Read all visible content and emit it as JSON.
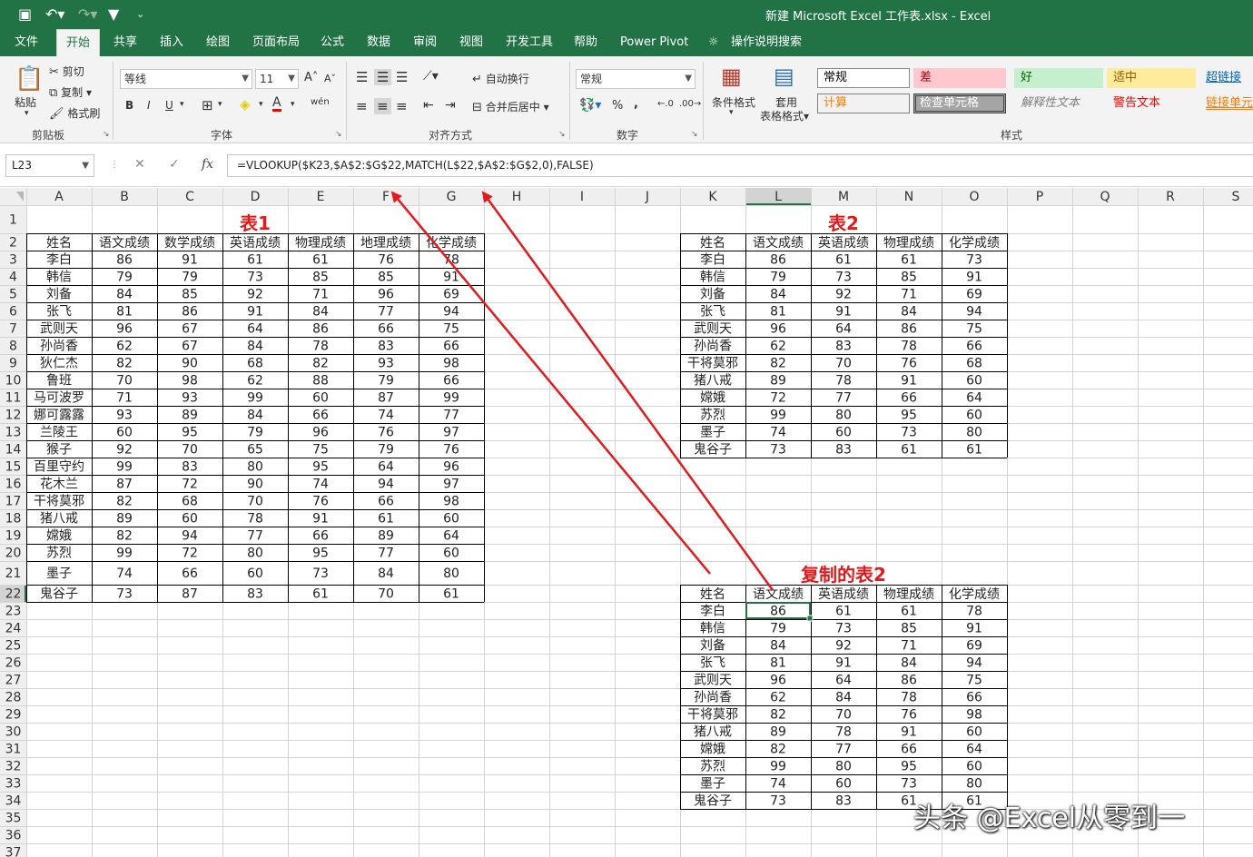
{
  "titlebar": {
    "title": "新建 Microsoft Excel 工作表.xlsx  -  Excel",
    "qa_icons": [
      "save-icon",
      "undo-icon",
      "redo-icon",
      "filter-icon",
      "customize-icon"
    ]
  },
  "tabs": [
    "文件",
    "开始",
    "共享",
    "插入",
    "绘图",
    "页面布局",
    "公式",
    "数据",
    "审阅",
    "视图",
    "开发工具",
    "帮助",
    "Power Pivot",
    "操作说明搜索"
  ],
  "active_tab": "开始",
  "ribbon": {
    "clipboard": {
      "paste": "粘贴",
      "cut": "剪切",
      "copy": "复制",
      "format_painter": "格式刷",
      "group": "剪贴板"
    },
    "font": {
      "name": "等线",
      "size": "11",
      "group": "字体",
      "bold": "B",
      "italic": "I",
      "underline": "U",
      "grow": "A˄",
      "shrink": "A˅",
      "wen": "wén"
    },
    "align": {
      "wrap": "自动换行",
      "merge": "合并后居中",
      "group": "对齐方式"
    },
    "number": {
      "format": "常规",
      "percent": "%",
      "comma": ",",
      "group": "数字"
    },
    "styles": {
      "cond": "条件格式",
      "table1": "套用",
      "table2": "表格格式",
      "group": "样式",
      "cells": [
        {
          "label": "常规",
          "bg": "#ffffff",
          "fg": "#000000",
          "border": "#8a8a8a"
        },
        {
          "label": "差",
          "bg": "#ffc7ce",
          "fg": "#9c0006",
          "border": "#ffc7ce"
        },
        {
          "label": "好",
          "bg": "#c6efce",
          "fg": "#006100",
          "border": "#c6efce"
        },
        {
          "label": "适中",
          "bg": "#ffeb9c",
          "fg": "#9c5700",
          "border": "#ffeb9c"
        },
        {
          "label": "超链接",
          "bg": "#f3f3f3",
          "fg": "#0563c1",
          "border": "#f3f3f3"
        },
        {
          "label": "计算",
          "bg": "#f2f2f2",
          "fg": "#fa7d00",
          "border": "#7f7f7f"
        },
        {
          "label": "检查单元格",
          "bg": "#a5a5a5",
          "fg": "#ffffff",
          "border": "#3f3f3f"
        },
        {
          "label": "解释性文本",
          "bg": "#f3f3f3",
          "fg": "#7f7f7f",
          "border": "#f3f3f3"
        },
        {
          "label": "警告文本",
          "bg": "#f3f3f3",
          "fg": "#ff0000",
          "border": "#f3f3f3"
        },
        {
          "label": "链接单元",
          "bg": "#f3f3f3",
          "fg": "#fa7d00",
          "border": "#f3f3f3"
        }
      ]
    }
  },
  "formula_bar": {
    "cell_ref": "L23",
    "fx": "fx",
    "formula": "=VLOOKUP($K23,$A$2:$G$22,MATCH(L$22,$A$2:$G$2,0),FALSE)"
  },
  "sheet": {
    "columns": [
      "A",
      "B",
      "C",
      "D",
      "E",
      "F",
      "G",
      "H",
      "I",
      "J",
      "K",
      "L",
      "M",
      "N",
      "O",
      "P",
      "Q",
      "R",
      "S"
    ],
    "rows": [
      "1",
      "2",
      "3",
      "4",
      "5",
      "6",
      "7",
      "8",
      "9",
      "10",
      "11",
      "12",
      "13",
      "14",
      "15",
      "16",
      "17",
      "18",
      "19",
      "20",
      "21",
      "22",
      "23",
      "24",
      "25",
      "26",
      "27",
      "28",
      "29",
      "30",
      "31",
      "32",
      "33",
      "34",
      "35",
      "36",
      "37"
    ],
    "selected_col": "L",
    "selected_row": "23",
    "table1": {
      "title": "表1",
      "header": [
        "姓名",
        "语文成绩",
        "数学成绩",
        "英语成绩",
        "物理成绩",
        "地理成绩",
        "化学成绩"
      ],
      "rows": [
        [
          "李白",
          "86",
          "91",
          "61",
          "61",
          "76",
          "78"
        ],
        [
          "韩信",
          "79",
          "79",
          "73",
          "85",
          "85",
          "91"
        ],
        [
          "刘备",
          "84",
          "85",
          "92",
          "71",
          "96",
          "69"
        ],
        [
          "张飞",
          "81",
          "86",
          "91",
          "84",
          "77",
          "94"
        ],
        [
          "武则天",
          "96",
          "67",
          "64",
          "86",
          "66",
          "75"
        ],
        [
          "孙尚香",
          "62",
          "67",
          "84",
          "78",
          "83",
          "66"
        ],
        [
          "狄仁杰",
          "82",
          "90",
          "68",
          "82",
          "93",
          "98"
        ],
        [
          "鲁班",
          "70",
          "98",
          "62",
          "88",
          "79",
          "66"
        ],
        [
          "马可波罗",
          "71",
          "93",
          "99",
          "60",
          "87",
          "99"
        ],
        [
          "娜可露露",
          "93",
          "89",
          "84",
          "66",
          "74",
          "77"
        ],
        [
          "兰陵王",
          "60",
          "95",
          "79",
          "96",
          "76",
          "97"
        ],
        [
          "猴子",
          "92",
          "70",
          "65",
          "75",
          "79",
          "76"
        ],
        [
          "百里守约",
          "99",
          "83",
          "80",
          "95",
          "64",
          "96"
        ],
        [
          "花木兰",
          "87",
          "72",
          "90",
          "74",
          "94",
          "97"
        ],
        [
          "干将莫邪",
          "82",
          "68",
          "70",
          "76",
          "66",
          "98"
        ],
        [
          "猪八戒",
          "89",
          "60",
          "78",
          "91",
          "61",
          "60"
        ],
        [
          "嫦娥",
          "82",
          "94",
          "77",
          "66",
          "89",
          "64"
        ],
        [
          "苏烈",
          "99",
          "72",
          "80",
          "95",
          "77",
          "60"
        ],
        [
          "墨子",
          "74",
          "66",
          "60",
          "73",
          "84",
          "80"
        ],
        [
          "鬼谷子",
          "73",
          "87",
          "83",
          "61",
          "70",
          "61"
        ]
      ]
    },
    "table2": {
      "title": "表2",
      "header": [
        "姓名",
        "语文成绩",
        "英语成绩",
        "物理成绩",
        "化学成绩"
      ],
      "rows": [
        [
          "李白",
          "86",
          "61",
          "61",
          "73"
        ],
        [
          "韩信",
          "79",
          "73",
          "85",
          "91"
        ],
        [
          "刘备",
          "84",
          "92",
          "71",
          "69"
        ],
        [
          "张飞",
          "81",
          "91",
          "84",
          "94"
        ],
        [
          "武则天",
          "96",
          "64",
          "86",
          "75"
        ],
        [
          "孙尚香",
          "62",
          "83",
          "78",
          "66"
        ],
        [
          "干将莫邪",
          "82",
          "70",
          "76",
          "68"
        ],
        [
          "猪八戒",
          "89",
          "78",
          "91",
          "60"
        ],
        [
          "嫦娥",
          "72",
          "77",
          "66",
          "64"
        ],
        [
          "苏烈",
          "99",
          "80",
          "95",
          "60"
        ],
        [
          "墨子",
          "74",
          "60",
          "73",
          "80"
        ],
        [
          "鬼谷子",
          "73",
          "83",
          "61",
          "61"
        ]
      ]
    },
    "table3": {
      "title": "复制的表2",
      "header": [
        "姓名",
        "语文成绩",
        "英语成绩",
        "物理成绩",
        "化学成绩"
      ],
      "rows": [
        [
          "李白",
          "86",
          "61",
          "61",
          "78"
        ],
        [
          "韩信",
          "79",
          "73",
          "85",
          "91"
        ],
        [
          "刘备",
          "84",
          "92",
          "71",
          "69"
        ],
        [
          "张飞",
          "81",
          "91",
          "84",
          "94"
        ],
        [
          "武则天",
          "96",
          "64",
          "86",
          "75"
        ],
        [
          "孙尚香",
          "62",
          "84",
          "78",
          "66"
        ],
        [
          "干将莫邪",
          "82",
          "70",
          "76",
          "98"
        ],
        [
          "猪八戒",
          "89",
          "78",
          "91",
          "60"
        ],
        [
          "嫦娥",
          "82",
          "77",
          "66",
          "64"
        ],
        [
          "苏烈",
          "99",
          "80",
          "95",
          "60"
        ],
        [
          "墨子",
          "74",
          "60",
          "73",
          "80"
        ],
        [
          "鬼谷子",
          "73",
          "83",
          "61",
          "61"
        ]
      ]
    }
  },
  "annotation_color": "#e31a1c",
  "watermark": "头条 @Excel从零到一"
}
